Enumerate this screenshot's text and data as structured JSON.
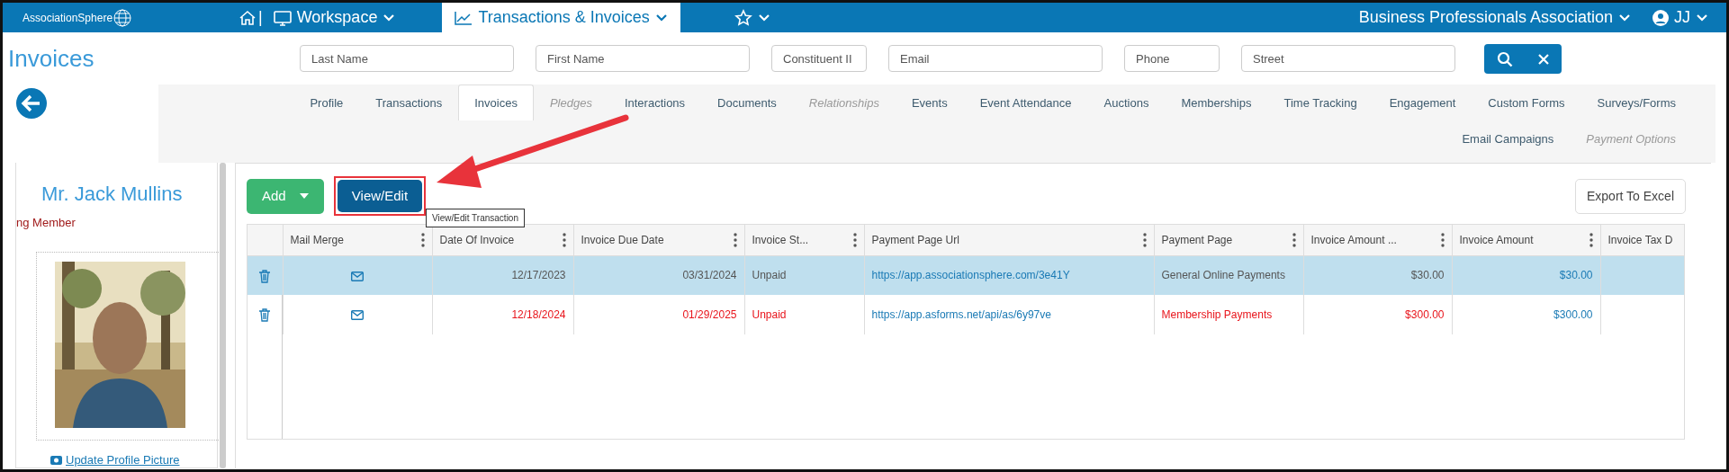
{
  "top_nav": {
    "logo": "AssociationSphere",
    "separator": "|",
    "items": [
      {
        "kind": "home",
        "selected": false
      },
      {
        "kind": "workspace",
        "label": "Workspace",
        "selected": false
      },
      {
        "kind": "chart",
        "label": "Transactions & Invoices",
        "selected": true
      },
      {
        "kind": "star",
        "selected": false
      }
    ],
    "organization": "Business Professionals Association",
    "user": "JJ"
  },
  "page_title": "Invoices",
  "search": {
    "fields": [
      {
        "placeholder": "Last Name"
      },
      {
        "placeholder": "First Name"
      },
      {
        "placeholder": "Constituent II"
      },
      {
        "placeholder": "Email"
      },
      {
        "placeholder": "Phone"
      },
      {
        "placeholder": "Street"
      }
    ]
  },
  "tab_rows": [
    [
      {
        "label": "Profile",
        "selected": false,
        "disabled": false
      },
      {
        "label": "Transactions",
        "selected": false,
        "disabled": false
      },
      {
        "label": "Invoices",
        "selected": true,
        "disabled": false
      },
      {
        "label": "Pledges",
        "selected": false,
        "disabled": true
      },
      {
        "label": "Interactions",
        "selected": false,
        "disabled": false
      },
      {
        "label": "Documents",
        "selected": false,
        "disabled": false
      },
      {
        "label": "Relationships",
        "selected": false,
        "disabled": true
      },
      {
        "label": "Events",
        "selected": false,
        "disabled": false
      },
      {
        "label": "Event Attendance",
        "selected": false,
        "disabled": false
      },
      {
        "label": "Auctions",
        "selected": false,
        "disabled": false
      },
      {
        "label": "Memberships",
        "selected": false,
        "disabled": false
      },
      {
        "label": "Time Tracking",
        "selected": false,
        "disabled": false
      },
      {
        "label": "Engagement",
        "selected": false,
        "disabled": false
      },
      {
        "label": "Custom Forms",
        "selected": false,
        "disabled": false
      },
      {
        "label": "Surveys/Forms",
        "selected": false,
        "disabled": false
      }
    ],
    [
      {
        "label": "Email Campaigns",
        "selected": false,
        "disabled": false
      },
      {
        "label": "Payment Options",
        "selected": false,
        "disabled": true
      }
    ]
  ],
  "contact": {
    "name": "Mr. Jack Mullins",
    "membership": "ng Member",
    "update_link": "Update Profile Picture"
  },
  "toolbar": {
    "add": "Add",
    "view_edit": "View/Edit",
    "tooltip": "View/Edit Transaction",
    "export": "Export To Excel"
  },
  "table": {
    "columns": [
      "Mail Merge",
      "Date Of Invoice",
      "Invoice Due Date",
      "Invoice St...",
      "Payment Page Url",
      "Payment Page",
      "Invoice Amount ...",
      "Invoice Amount",
      "Invoice Tax D"
    ],
    "rows": [
      {
        "selected": true,
        "flagged": false,
        "cells": [
          "",
          "12/17/2023",
          "03/31/2024",
          "Unpaid",
          "https://app.associationsphere.com/3e41Y",
          "General Online Payments",
          "$30.00",
          "$30.00",
          ""
        ]
      },
      {
        "selected": false,
        "flagged": true,
        "cells": [
          "",
          "12/18/2024",
          "01/29/2025",
          "Unpaid",
          "https://app.asforms.net/api/as/6y97ve",
          "Membership Payments",
          "$300.00",
          "$300.00",
          ""
        ]
      }
    ]
  }
}
